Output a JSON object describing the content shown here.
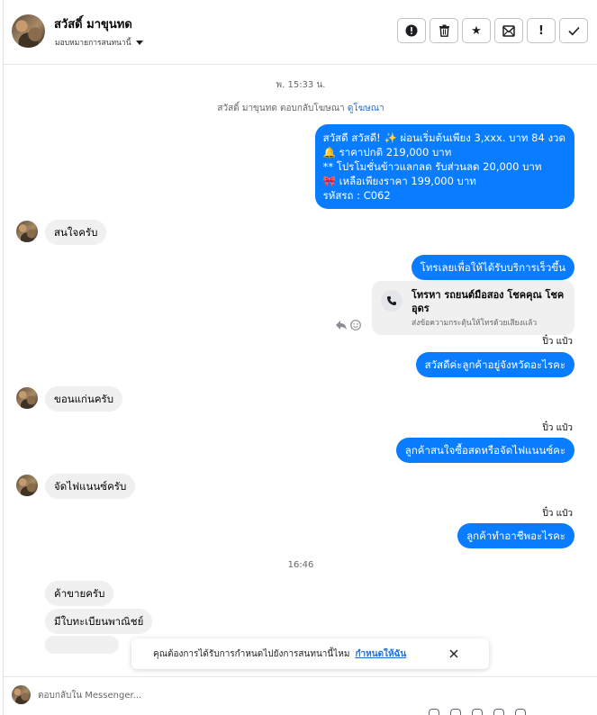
{
  "header": {
    "name": "สวัสดิ์ มาขุนทด",
    "assign_label": "มอบหมายการสนทนานี้",
    "actions": [
      {
        "icon": "exclamation-circle-icon",
        "glyph": "!"
      },
      {
        "icon": "trash-icon",
        "glyph": ""
      },
      {
        "icon": "star-icon",
        "glyph": "★"
      },
      {
        "icon": "mail-archive-icon",
        "glyph": ""
      },
      {
        "icon": "exclamation-icon",
        "glyph": "!"
      },
      {
        "icon": "check-icon",
        "glyph": "✓"
      }
    ]
  },
  "chat": {
    "timestamp_1": "พ. 15:33 น.",
    "ad_reply_text": "สวัสดิ์ มาขุนทด ตอบกลับโฆษณา",
    "ad_link": "ดูโฆษณา",
    "promo_lines": [
      "สวัสดี สวัสดี! ✨  ผ่อนเริ่มต้นเพียง 3,xxx. บาท 84 งวด",
      "🔔 ราคาปกติ 219,000 บาท",
      "** โปรโมชั่นข้าวแลกลด รับส่วนลด 20,000 บาท",
      "🎀  เหลือเพียงราคา 199,000 บาท",
      " รหัสรถ : C062"
    ],
    "in_1": "สนใจครับ",
    "out_call_prompt": "โทรเลยเพื่อให้ได้รับบริการเร็วขึ้น",
    "call_card_title": "โทรหา รถยนต์มือสอง โชคคุณ โชค อุดร",
    "call_card_sub": "ส่งข้อความกระตุ้นให้โทรด้วยเสียงแล้ว",
    "sender_1": "ปิ๋ว แป๋ว",
    "out_2": "สวัสดีค่ะลูกค้าอยู่จังหวัดอะไรคะ",
    "in_2": "ขอนแก่นครับ",
    "sender_2": "ปิ๋ว แป๋ว",
    "out_3": "ลูกค้าสนใจซื้อสดหรือจัดไฟแนนซ์คะ",
    "in_3": "จัดไฟแนนซ์ครับ",
    "sender_3": "ปิ๋ว แป๋ว",
    "out_4": "ลูกค้าทำอาชีพอะไรคะ",
    "timestamp_2": "16:46",
    "in_4": "ค้าขายครับ",
    "in_5": "มีใบทะเบียนพาณิชย์"
  },
  "toast": {
    "message": "คุณต้องการได้รับการกำหนดไปยังการสนทนานี้ไหม",
    "link": "กำหนดให้ฉัน"
  },
  "composer": {
    "placeholder": "ตอบกลับใน Messenger..."
  },
  "colors": {
    "accent": "#0a7cff",
    "incoming_bg": "#f0f0f0",
    "link": "#216fdb"
  }
}
